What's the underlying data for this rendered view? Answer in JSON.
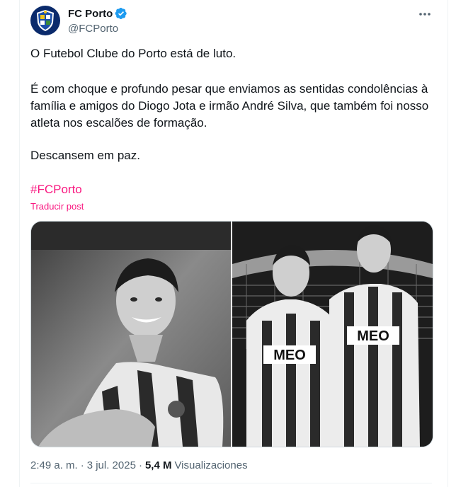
{
  "author": {
    "display_name": "FC Porto",
    "handle": "@FCPorto",
    "avatar_icon": "fc-porto-crest-icon",
    "verified_icon": "verified-badge-icon",
    "verified_color": "#1d9bf0"
  },
  "more_icon": "more-options-icon",
  "post": {
    "paragraph1": "O Futebol Clube do Porto está de luto.",
    "paragraph2": "É com choque e profundo pesar que enviamos as sentidas condolências à família e amigos do Diogo Jota e irmão André Silva, que também foi nosso atleta nos escalões de formação.",
    "paragraph3": "Descansem em paz.",
    "hashtag": "#FCPorto",
    "hashtag_color": "#f91880",
    "translate_label": "Traducir post"
  },
  "meta": {
    "time": "2:49 a. m.",
    "separator": "·",
    "date": "3 jul. 2025",
    "views_count": "5,4 M",
    "views_label": "Visualizaciones"
  },
  "media": {
    "sponsor_text": "MEO"
  }
}
